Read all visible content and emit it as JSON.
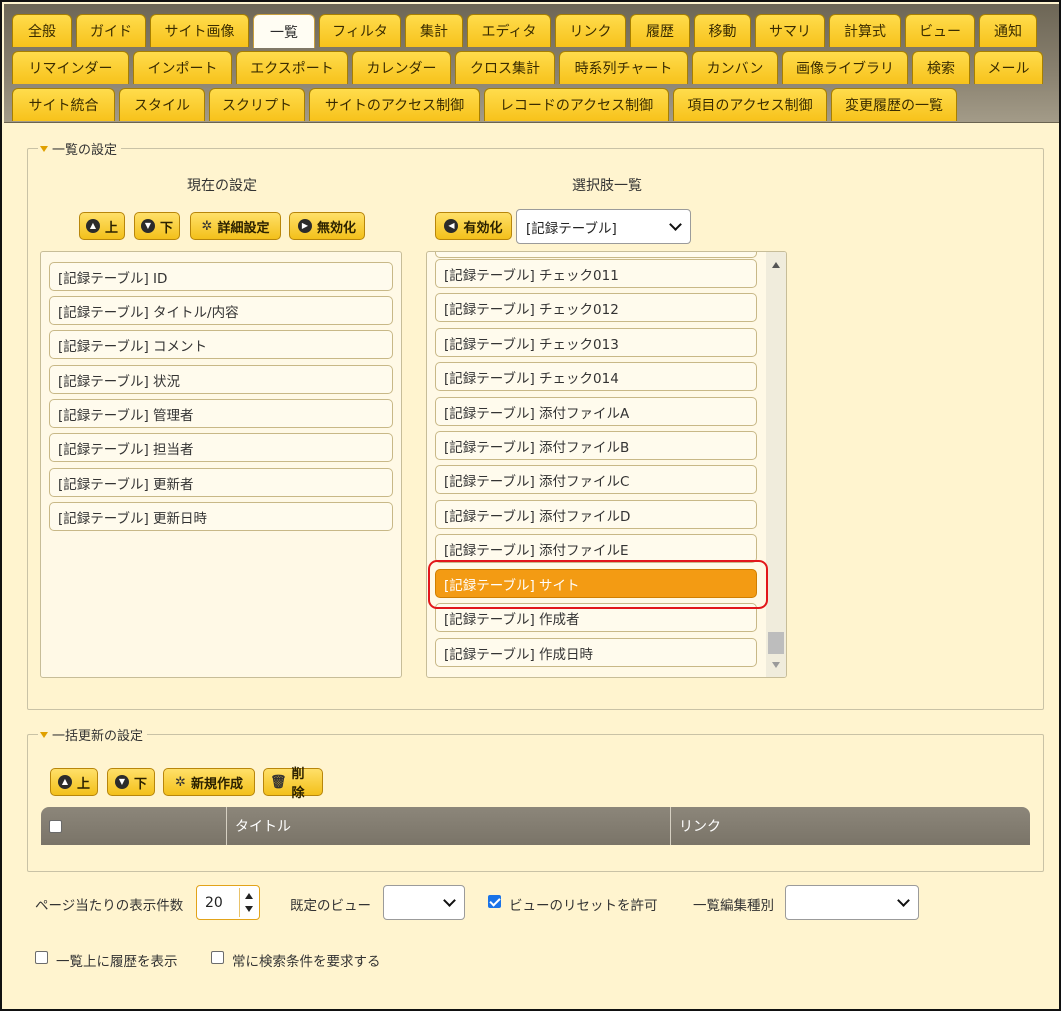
{
  "tabs": {
    "row1": [
      "全般",
      "ガイド",
      "サイト画像",
      "一覧",
      "フィルタ",
      "集計",
      "エディタ",
      "リンク",
      "履歴",
      "移動",
      "サマリ",
      "計算式",
      "ビュー",
      "通知"
    ],
    "row2": [
      "リマインダー",
      "インポート",
      "エクスポート",
      "カレンダー",
      "クロス集計",
      "時系列チャート",
      "カンバン",
      "画像ライブラリ",
      "検索",
      "メール"
    ],
    "row3": [
      "サイト統合",
      "スタイル",
      "スクリプト",
      "サイトのアクセス制御",
      "レコードのアクセス制御",
      "項目のアクセス制御",
      "変更履歴の一覧"
    ],
    "active": "一覧"
  },
  "list_settings": {
    "legend": "一覧の設定",
    "current": {
      "title": "現在の設定",
      "buttons": {
        "up": "上",
        "down": "下",
        "detail": "詳細設定",
        "disable": "無効化"
      },
      "items": [
        "[記録テーブル] ID",
        "[記録テーブル] タイトル/内容",
        "[記録テーブル] コメント",
        "[記録テーブル] 状況",
        "[記録テーブル] 管理者",
        "[記録テーブル] 担当者",
        "[記録テーブル] 更新者",
        "[記録テーブル] 更新日時"
      ]
    },
    "options": {
      "title": "選択肢一覧",
      "buttons": {
        "enable": "有効化"
      },
      "select_value": "[記録テーブル]",
      "items": [
        "[記録テーブル] チェック011",
        "[記録テーブル] チェック012",
        "[記録テーブル] チェック013",
        "[記録テーブル] チェック014",
        "[記録テーブル] 添付ファイルA",
        "[記録テーブル] 添付ファイルB",
        "[記録テーブル] 添付ファイルC",
        "[記録テーブル] 添付ファイルD",
        "[記録テーブル] 添付ファイルE",
        "[記録テーブル] サイト",
        "[記録テーブル] 作成者",
        "[記録テーブル] 作成日時"
      ],
      "selected_index": 9
    }
  },
  "bulk_update": {
    "legend": "一括更新の設定",
    "buttons": {
      "up": "上",
      "down": "下",
      "new": "新規作成",
      "delete": "削除"
    },
    "table": {
      "col_title": "タイトル",
      "col_link": "リンク"
    }
  },
  "footer": {
    "per_page_label": "ページ当たりの表示件数",
    "per_page_value": "20",
    "default_view_label": "既定のビュー",
    "default_view_value": "",
    "allow_reset_label": "ビューのリセットを許可",
    "allow_reset_checked": true,
    "edit_type_label": "一覧編集種別",
    "edit_type_value": "",
    "show_history_label": "一覧上に履歴を表示",
    "show_history_checked": false,
    "require_search_label": "常に検索条件を要求する",
    "require_search_checked": false
  },
  "colors": {
    "tab_gold": "#f7c21b",
    "selected_orange": "#f39b13",
    "highlight_red": "#e2171b",
    "panel_bg": "#fff4cf"
  }
}
